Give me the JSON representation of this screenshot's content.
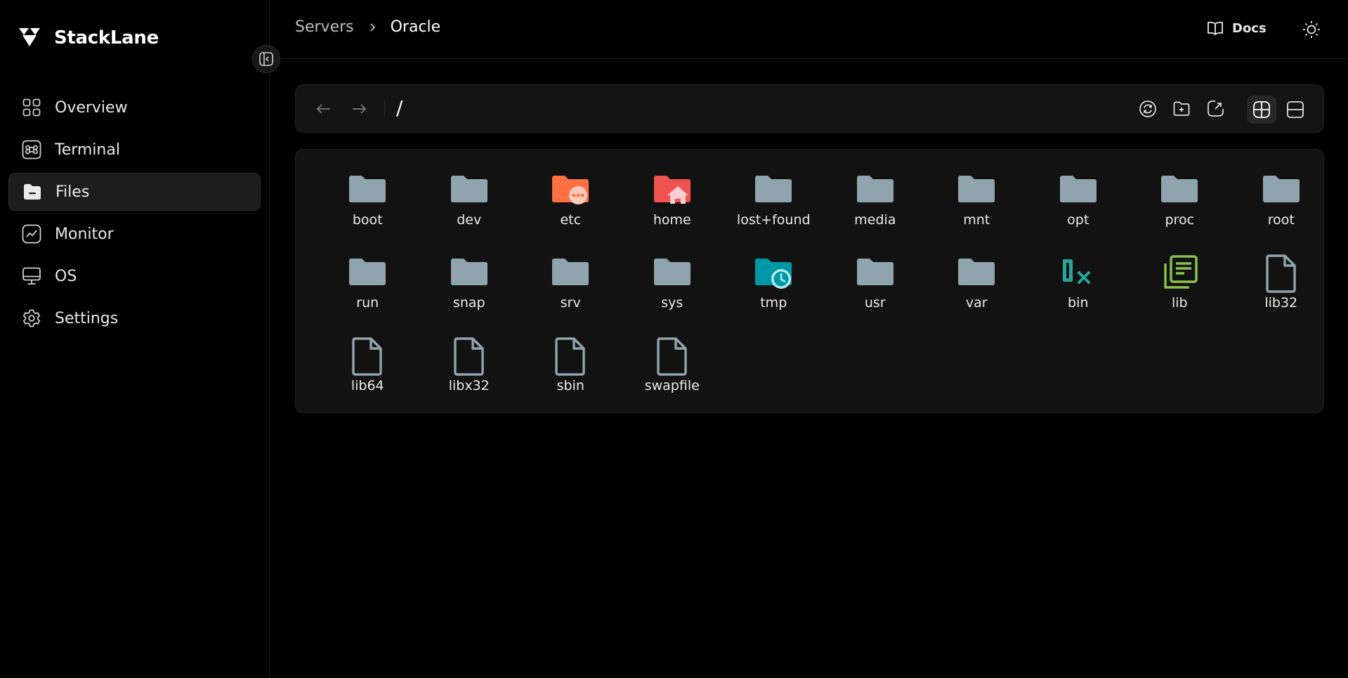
{
  "brand": {
    "name": "StackLane"
  },
  "sidebar": {
    "items": [
      {
        "label": "Overview",
        "icon": "grid-icon",
        "active": false
      },
      {
        "label": "Terminal",
        "icon": "command-icon",
        "active": false
      },
      {
        "label": "Files",
        "icon": "folder-open-icon",
        "active": true
      },
      {
        "label": "Monitor",
        "icon": "chart-icon",
        "active": false
      },
      {
        "label": "OS",
        "icon": "monitor-icon",
        "active": false
      },
      {
        "label": "Settings",
        "icon": "gear-icon",
        "active": false
      }
    ]
  },
  "header": {
    "breadcrumb": {
      "parent": "Servers",
      "current": "Oracle"
    },
    "docs_label": "Docs"
  },
  "toolbar": {
    "path": "/"
  },
  "colors": {
    "folder": "#90a4ae",
    "folder_etc": "#ff7043",
    "folder_home": "#ef5350",
    "folder_tmp": "#0097a7",
    "bin": "#26a69a",
    "lib": "#8bc34a",
    "file": "#90a4ae"
  },
  "files": [
    {
      "name": "boot",
      "icon": "folder-icon"
    },
    {
      "name": "dev",
      "icon": "folder-icon"
    },
    {
      "name": "etc",
      "icon": "folder-config-icon"
    },
    {
      "name": "home",
      "icon": "folder-home-icon"
    },
    {
      "name": "lost+found",
      "icon": "folder-icon"
    },
    {
      "name": "media",
      "icon": "folder-icon"
    },
    {
      "name": "mnt",
      "icon": "folder-icon"
    },
    {
      "name": "opt",
      "icon": "folder-icon"
    },
    {
      "name": "proc",
      "icon": "folder-icon"
    },
    {
      "name": "root",
      "icon": "folder-icon"
    },
    {
      "name": "run",
      "icon": "folder-icon"
    },
    {
      "name": "snap",
      "icon": "folder-icon"
    },
    {
      "name": "srv",
      "icon": "folder-icon"
    },
    {
      "name": "sys",
      "icon": "folder-icon"
    },
    {
      "name": "tmp",
      "icon": "folder-temp-icon"
    },
    {
      "name": "usr",
      "icon": "folder-icon"
    },
    {
      "name": "var",
      "icon": "folder-icon"
    },
    {
      "name": "bin",
      "icon": "binary-file-icon"
    },
    {
      "name": "lib",
      "icon": "library-file-icon"
    },
    {
      "name": "lib32",
      "icon": "file-icon"
    },
    {
      "name": "lib64",
      "icon": "file-icon"
    },
    {
      "name": "libx32",
      "icon": "file-icon"
    },
    {
      "name": "sbin",
      "icon": "file-icon"
    },
    {
      "name": "swapfile",
      "icon": "file-icon"
    }
  ]
}
